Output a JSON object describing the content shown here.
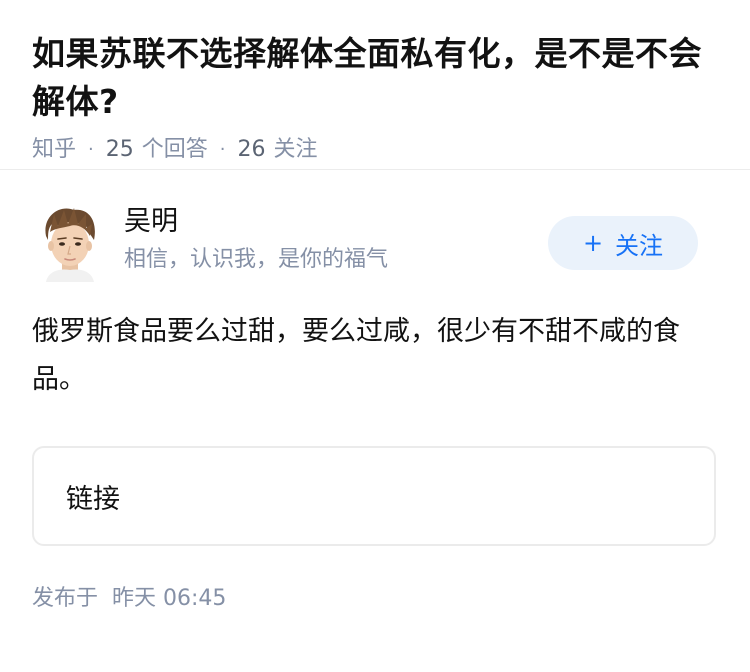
{
  "question": {
    "title": "如果苏联不选择解体全面私有化，是不是不会解体?",
    "source": "知乎",
    "answer_count": "25",
    "answer_label": "个回答",
    "follow_count": "26",
    "follow_label": "关注"
  },
  "answer": {
    "author_name": "吴明",
    "author_bio": "相信，认识我，是你的福气",
    "follow_button_plus": "+",
    "follow_button_label": "关注",
    "content": "俄罗斯食品要么过甜，要么过咸，很少有不甜不咸的食品。",
    "link_card_label": "链接",
    "publish_prefix": "发布于",
    "publish_time": "昨天 06:45"
  },
  "icons": {
    "avatar": "cartoon-face-avatar"
  },
  "colors": {
    "accent": "#1772f6",
    "follow_bg": "#eaf2fb",
    "meta_text": "#8590a6"
  }
}
